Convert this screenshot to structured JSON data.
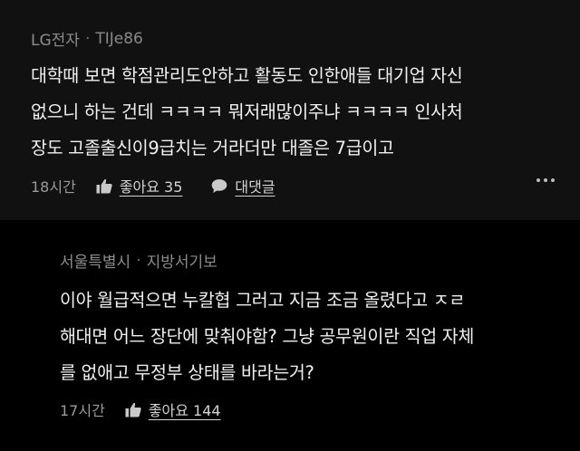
{
  "comment": {
    "author_company": "LG전자",
    "separator": "·",
    "author_nick": "TIJe86",
    "lines": [
      "대학때 보면 학점관리도안하고 활동도 인한애들 대기업 자신",
      "없으니 하는 건데 ㅋㅋㅋㅋ 뭐저래많이주냐 ㅋㅋㅋㅋ 인사처",
      "장도 고졸출신이9급치는 거라더만 대졸은 7급이고"
    ],
    "time": "18시간",
    "like_label": "좋아요 35",
    "reply_label": "대댓글"
  },
  "reply": {
    "author_company": "서울특별시",
    "separator": "·",
    "author_nick": "지방서기보",
    "lines": [
      "이야 월급적으면 누칼협 그러고 지금 조금 올렸다고 ㅈㄹ",
      "해대면 어느 장단에 맞춰야함? 그냥 공무원이란 직업 자체",
      "를 없애고 무정부 상태를 바라는거?"
    ],
    "time": "17시간",
    "like_label": "좋아요 144"
  },
  "icons": {
    "like": "thumbs-up-icon",
    "reply": "speech-bubble-icon",
    "more": "more-dots-icon"
  }
}
